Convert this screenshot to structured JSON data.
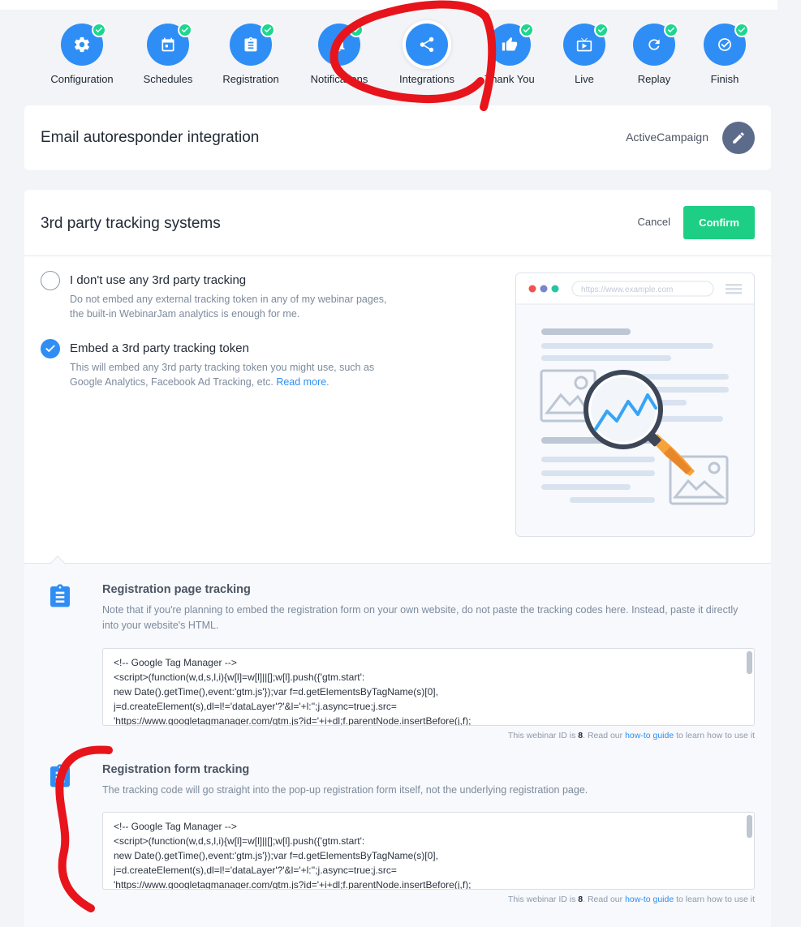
{
  "stepper": {
    "steps": [
      {
        "label": "Configuration",
        "icon": "gear-icon"
      },
      {
        "label": "Schedules",
        "icon": "calendar-icon"
      },
      {
        "label": "Registration",
        "icon": "clipboard-icon"
      },
      {
        "label": "Notifications",
        "icon": "bell-icon"
      },
      {
        "label": "Integrations",
        "icon": "share-icon"
      },
      {
        "label": "Thank You",
        "icon": "thumbs-up-icon"
      },
      {
        "label": "Live",
        "icon": "tv-icon"
      },
      {
        "label": "Replay",
        "icon": "replay-icon"
      },
      {
        "label": "Finish",
        "icon": "check-circle-icon"
      }
    ],
    "active_step": "Integrations"
  },
  "email_integration": {
    "title": "Email autoresponder integration",
    "provider": "ActiveCampaign"
  },
  "tracking": {
    "title": "3rd party tracking systems",
    "cancel_label": "Cancel",
    "confirm_label": "Confirm",
    "options": [
      {
        "title": "I don't use any 3rd party tracking",
        "description": "Do not embed any external tracking token in any of my webinar pages, the built-in WebinarJam analytics is enough for me.",
        "checked": false
      },
      {
        "title": "Embed a 3rd party tracking token",
        "description": "This will embed any 3rd party tracking token you might use, such as Google Analytics, Facebook Ad Tracking, etc.",
        "link_label": "Read more",
        "checked": true
      }
    ],
    "illustration": {
      "url_placeholder": "https://www.example.com"
    },
    "sections": [
      {
        "title": "Registration page tracking",
        "description": "Note that if you're planning to embed the registration form on your own website, do not paste the tracking codes here. Instead, paste it directly into your website's HTML.",
        "code_lines": [
          "<!-- Google Tag Manager -->",
          "<script>(function(w,d,s,l,i){w[l]=w[l]||[];w[l].push({'gtm.start':",
          "new Date().getTime(),event:'gtm.js'});var f=d.getElementsByTagName(s)[0],",
          "j=d.createElement(s),dl=l!='dataLayer'?'&l='+l:'';j.async=true;j.src=",
          "'https://www.googletagmanager.com/gtm.js?id='+i+dl;f.parentNode.insertBefore(j,f);"
        ]
      },
      {
        "title": "Registration form tracking",
        "description": "The tracking code will go straight into the pop-up registration form itself, not the underlying registration page.",
        "code_lines": [
          "<!-- Google Tag Manager -->",
          "<script>(function(w,d,s,l,i){w[l]=w[l]||[];w[l].push({'gtm.start':",
          "new Date().getTime(),event:'gtm.js'});var f=d.getElementsByTagName(s)[0],",
          "j=d.createElement(s),dl=l!='dataLayer'?'&l='+l:'';j.async=true;j.src=",
          "'https://www.googletagmanager.com/gtm.js?id='+i+dl;f.parentNode.insertBefore(j,f);"
        ]
      }
    ],
    "hint": {
      "prefix": "This webinar ID is ",
      "webinar_id": "8",
      "middle": ". Read our ",
      "link_label": "how-to guide",
      "suffix": " to learn how to use it"
    }
  },
  "colors": {
    "primary": "#2f8ef5",
    "success": "#1ccf85",
    "check_badge": "#1ed68f",
    "annotation": "#e8141c"
  }
}
